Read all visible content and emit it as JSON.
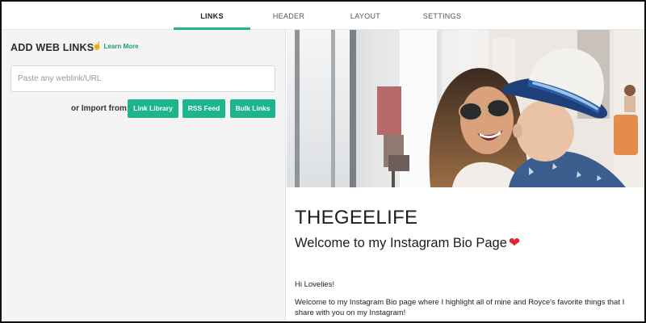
{
  "tabs": [
    {
      "label": "LINKS",
      "active": true
    },
    {
      "label": "HEADER",
      "active": false
    },
    {
      "label": "LAYOUT",
      "active": false
    },
    {
      "label": "SETTINGS",
      "active": false
    }
  ],
  "links_panel": {
    "title": "ADD WEB LINKS",
    "learn_more": "Learn More",
    "url_placeholder": "Paste any weblink/URL",
    "url_value": "",
    "import_label": "or Import from:",
    "buttons": {
      "link_library": "Link Library",
      "rss_feed": "RSS Feed",
      "bulk_links": "Bulk Links"
    }
  },
  "preview": {
    "profile_name": "THEGEELIFE",
    "subtitle": "Welcome to my Instagram Bio Page",
    "subtitle_emoji": "❤",
    "greeting": "Hi Lovelies!",
    "intro": "Welcome to my Instagram Bio page where I highlight all of mine and Royce's favorite things that I share with you on my Instagram!"
  },
  "colors": {
    "accent": "#1cb58c",
    "panel_bg": "#f4f4f4",
    "heart": "#e2222d"
  },
  "icons": {
    "learn_more": "pointing-hand-icon"
  }
}
